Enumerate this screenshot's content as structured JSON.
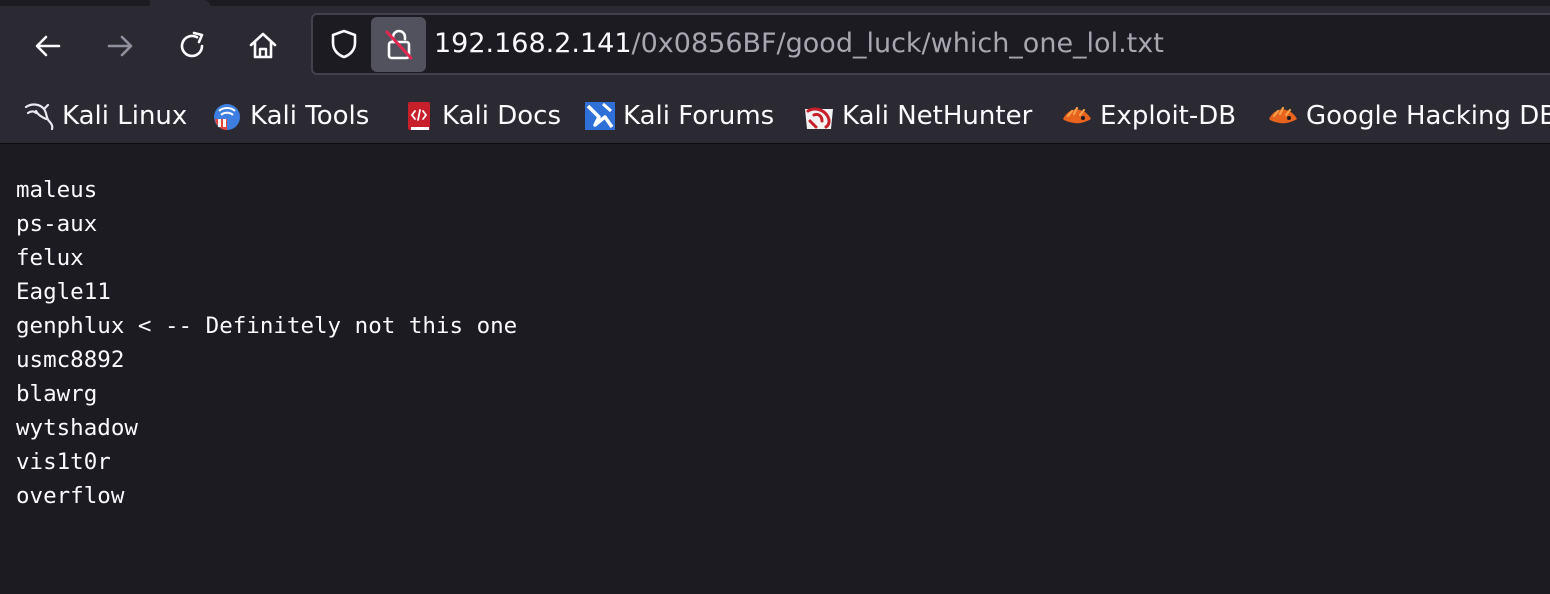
{
  "browser": {
    "nav": {
      "back_icon": "arrow-left-icon",
      "forward_icon": "arrow-right-icon",
      "reload_icon": "reload-icon",
      "home_icon": "home-icon"
    },
    "urlbar": {
      "host": "192.168.2.141",
      "path": "/0x0856BF/good_luck/which_one_lol.txt",
      "shield_icon": "tracking-protection-shield-icon",
      "lock_icon": "insecure-lock-icon"
    },
    "bookmarks": [
      {
        "label": "Kali Linux",
        "icon": "kali-dragon-icon"
      },
      {
        "label": "Kali Tools",
        "icon": "kali-tools-icon"
      },
      {
        "label": "Kali Docs",
        "icon": "kali-docs-icon"
      },
      {
        "label": "Kali Forums",
        "icon": "kali-forums-icon"
      },
      {
        "label": "Kali NetHunter",
        "icon": "kali-nethunter-icon"
      },
      {
        "label": "Exploit-DB",
        "icon": "exploit-db-icon"
      },
      {
        "label": "Google Hacking DB",
        "icon": "google-hacking-db-icon"
      }
    ]
  },
  "document": {
    "lines": [
      "maleus",
      "ps-aux",
      "felux",
      "Eagle11",
      "genphlux < -- Definitely not this one",
      "usmc8892",
      "blawrg",
      "wytshadow",
      "vis1t0r",
      "overflow"
    ]
  },
  "colors": {
    "toolbar_bg": "#2b2a33",
    "page_bg": "#1c1b22",
    "text": "#fbfbfe",
    "url_path": "#a8a7b0"
  }
}
